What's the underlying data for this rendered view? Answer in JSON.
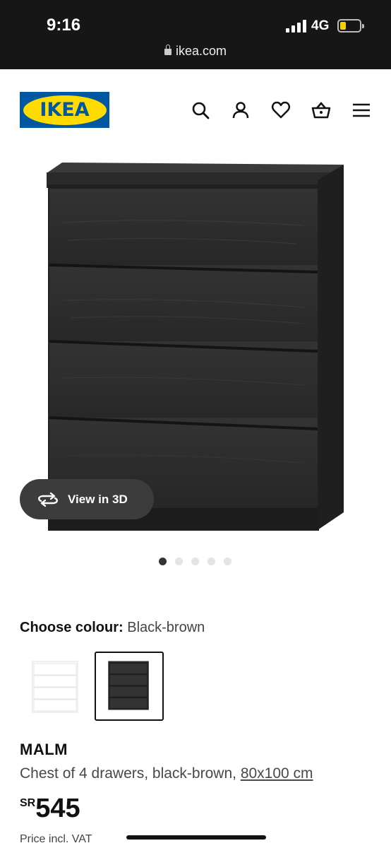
{
  "status_bar": {
    "time": "9:16",
    "network": "4G",
    "url": "ikea.com"
  },
  "header": {
    "logo_text": "IKEA",
    "icons": [
      "search-icon",
      "user-icon",
      "heart-icon",
      "basket-icon",
      "menu-icon"
    ]
  },
  "gallery": {
    "view3d_label": "View in 3D",
    "dot_count": 5,
    "active_index": 0
  },
  "colour": {
    "label": "Choose colour:",
    "value": "Black-brown",
    "options": [
      "White",
      "Black-brown"
    ],
    "selected_index": 1
  },
  "product": {
    "name": "MALM",
    "description": "Chest of 4 drawers, black-brown,",
    "dimensions": "80x100 cm",
    "currency": "SR",
    "price": "545",
    "vat_note": "Price incl. VAT"
  },
  "colors": {
    "brand_blue": "#0058a3",
    "brand_yellow": "#ffdb00",
    "furniture": "#2b2b2b"
  }
}
